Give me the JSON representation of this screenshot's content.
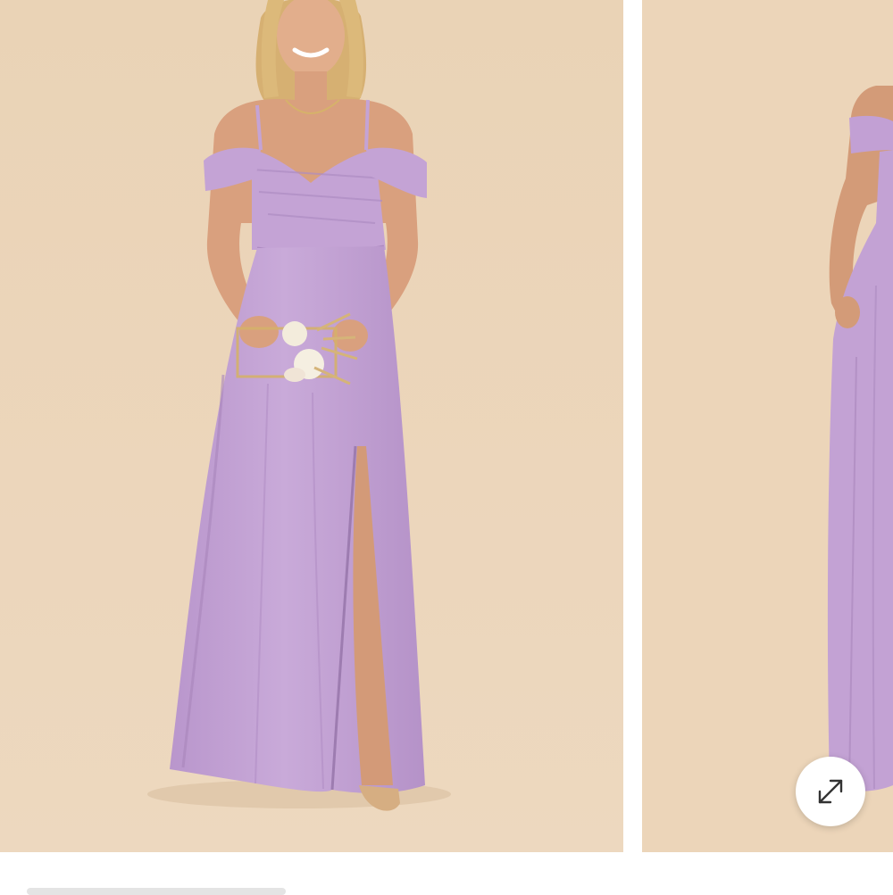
{
  "gallery": {
    "colors": {
      "backdrop": "#ecd5b9",
      "dress": "#c6a6d6",
      "dress_shadow": "#a887bb",
      "skin": "#d9a07e",
      "hair": "#d8b477",
      "page": "#ffffff"
    },
    "slides": [
      {
        "subject": "model-front-view"
      },
      {
        "subject": "model-side-view"
      }
    ],
    "expand_icon": "expand-diagonal-arrows-icon"
  }
}
